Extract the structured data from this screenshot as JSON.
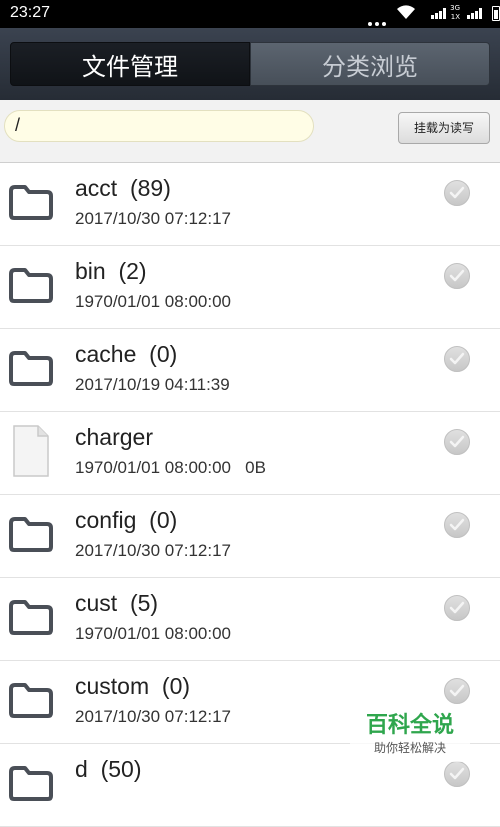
{
  "status_bar": {
    "time": "23:27",
    "network_top": "3G",
    "network_bottom": "1X"
  },
  "tabs": {
    "file_manager": "文件管理",
    "category_browse": "分类浏览"
  },
  "path_bar": {
    "path": "/",
    "mount_button": "挂载为读写"
  },
  "files": [
    {
      "name": "acct  (89)",
      "meta": "2017/10/30 07:12:17",
      "type": "folder"
    },
    {
      "name": "bin  (2)",
      "meta": "1970/01/01 08:00:00",
      "type": "folder"
    },
    {
      "name": "cache  (0)",
      "meta": "2017/10/19 04:11:39",
      "type": "folder"
    },
    {
      "name": "charger",
      "meta": "1970/01/01 08:00:00   0B",
      "type": "file"
    },
    {
      "name": "config  (0)",
      "meta": "2017/10/30 07:12:17",
      "type": "folder"
    },
    {
      "name": "cust  (5)",
      "meta": "1970/01/01 08:00:00",
      "type": "folder"
    },
    {
      "name": "custom  (0)",
      "meta": "2017/10/30 07:12:17",
      "type": "folder"
    },
    {
      "name": "d  (50)",
      "meta": "",
      "type": "folder"
    }
  ],
  "watermark": {
    "title": "百科全说",
    "subtitle": "助你轻松解决"
  }
}
